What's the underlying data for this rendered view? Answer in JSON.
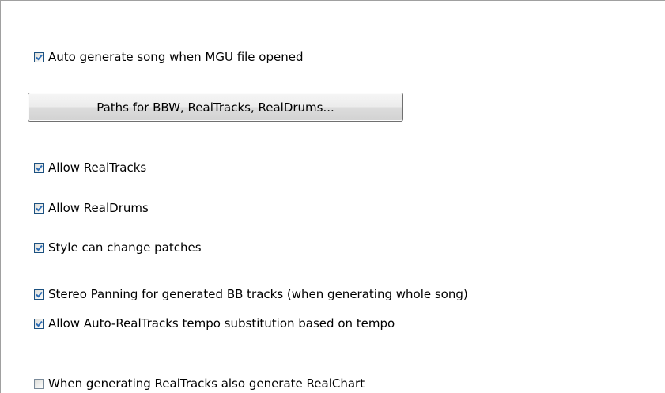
{
  "options": {
    "auto_generate": {
      "label": "Auto generate song when MGU file opened",
      "checked": true
    },
    "paths_button_label": "Paths for BBW, RealTracks, RealDrums...",
    "allow_realtracks": {
      "label": "Allow RealTracks",
      "checked": true
    },
    "allow_realdrums": {
      "label": "Allow RealDrums",
      "checked": true
    },
    "style_patches": {
      "label": "Style can change patches",
      "checked": true
    },
    "stereo_panning": {
      "label": "Stereo Panning for generated BB tracks (when generating whole song)",
      "checked": true
    },
    "auto_realtracks_tempo": {
      "label": "Allow Auto-RealTracks tempo substitution based on tempo",
      "checked": true
    },
    "generate_realchart": {
      "label": "When generating RealTracks also generate RealChart",
      "checked": false
    }
  },
  "colors": {
    "check_mark": "#21a121",
    "checkbox_border": "#1c5180",
    "background": "#ffffff"
  }
}
